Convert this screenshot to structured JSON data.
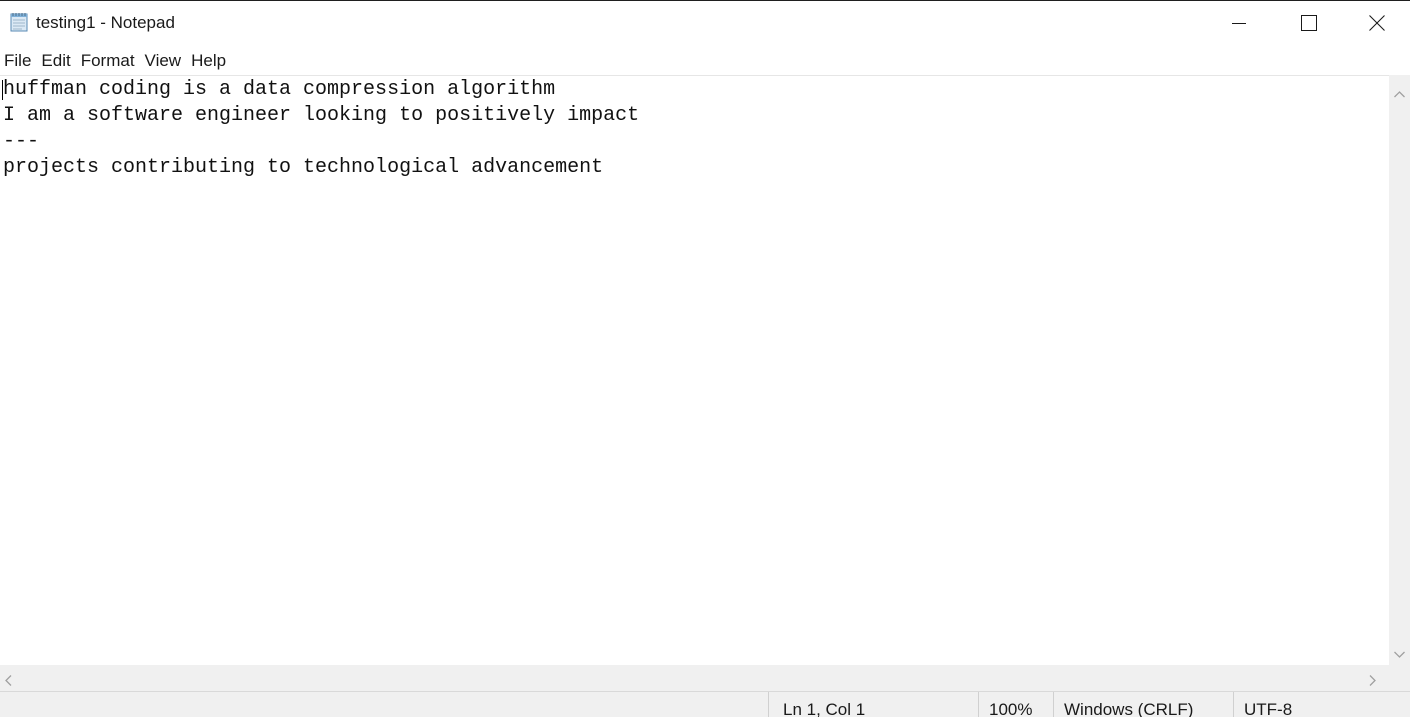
{
  "window": {
    "title": "testing1 - Notepad",
    "app_icon": "notepad-icon"
  },
  "title_buttons": {
    "minimize_icon": "minimize-icon",
    "maximize_icon": "maximize-icon",
    "close_icon": "close-icon"
  },
  "menu": {
    "items": [
      {
        "label": "File"
      },
      {
        "label": "Edit"
      },
      {
        "label": "Format"
      },
      {
        "label": "View"
      },
      {
        "label": "Help"
      }
    ]
  },
  "editor": {
    "lines": [
      "huffman coding is a data compression algorithm",
      "I am a software engineer looking to positively impact",
      "---",
      "projects contributing to technological advancement"
    ]
  },
  "statusbar": {
    "position": "Ln 1, Col 1",
    "zoom": "100%",
    "line_ending": "Windows (CRLF)",
    "encoding": "UTF-8"
  },
  "colors": {
    "background": "#ffffff",
    "chrome": "#f0f0f0",
    "text": "#1a1a1a"
  }
}
